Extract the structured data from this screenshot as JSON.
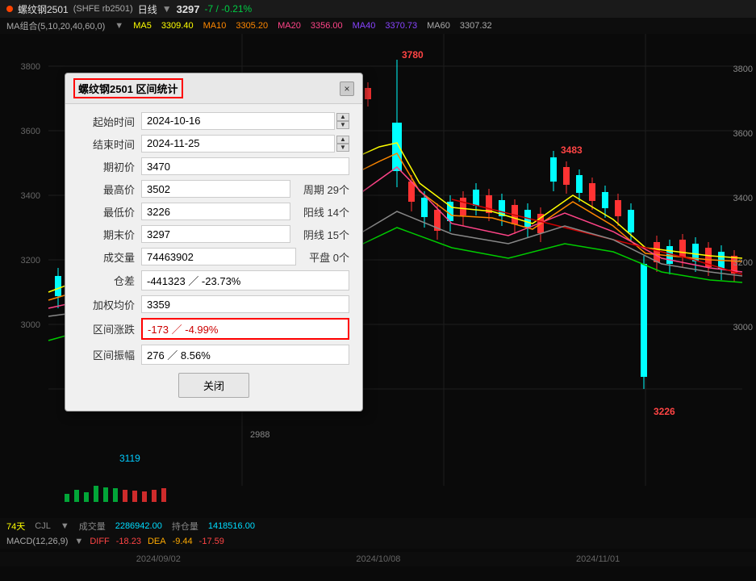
{
  "topbar": {
    "dot_color": "#ff4400",
    "title": "螺纹钢2501",
    "exchange": "(SHFE rb2501)",
    "period": "日线",
    "price": "3297",
    "change": "-7 / -0.21%"
  },
  "mabar": {
    "label": "MA组合(5,10,20,40,60,0)",
    "ma5_label": "MA5",
    "ma5_val": "3309.40",
    "ma10_label": "MA10",
    "ma10_val": "3305.20",
    "ma20_label": "MA20",
    "ma20_val": "3356.00",
    "ma40_label": "MA40",
    "ma40_val": "3370.73",
    "ma60_label": "MA60",
    "ma60_val": "3307.32"
  },
  "chart": {
    "price_3780": "3780",
    "price_3483": "3483",
    "price_3226": "3226",
    "price_3119": "3119",
    "y_labels": [
      "3800",
      "3600",
      "3400",
      "3200",
      "3000"
    ]
  },
  "bottombar": {
    "day_label": "74天",
    "price_2988": "2988",
    "cjl_label": "CJL",
    "chengjiao": "成交量",
    "cjl_val": "2286942.00",
    "chicang_label": "持仓量",
    "chicang_val": "1418516.00",
    "macd_label": "MACD(12,26,9)",
    "diff_label": "DIFF",
    "diff_val": "-18.23",
    "dea_label": "DEA",
    "dea_val": "-9.44",
    "macd_val": "-17.59"
  },
  "dates": {
    "d1": "2024/09/02",
    "d2": "2024/10/08",
    "d3": "2024/11/01"
  },
  "dialog": {
    "title": "螺纹钢2501 区间统计",
    "close_label": "×",
    "start_label": "起始时间",
    "start_val": "2024-10-16",
    "end_label": "结束时间",
    "end_val": "2024-11-25",
    "qichu_label": "期初价",
    "qichu_val": "3470",
    "zuigao_label": "最高价",
    "zuigao_val": "3502",
    "zuidi_label": "最低价",
    "zuidi_val": "3226",
    "qimo_label": "期末价",
    "qimo_val": "3297",
    "chengjiao_label": "成交量",
    "chengjiao_val": "74463902",
    "chadiff_label": "仓差",
    "chadiff_val": "-441323 ／ -23.73%",
    "jiaquan_label": "加权均价",
    "jiaquan_val": "3359",
    "rise_label": "区间涨跌",
    "rise_val": "-173 ／ -4.99%",
    "amplitude_label": "区间振幅",
    "amplitude_val": "276 ／ 8.56%",
    "zhouqi_label": "周期",
    "zhouqi_val": "29个",
    "yangxian_label": "阳线",
    "yangxian_val": "14个",
    "yinxian_label": "阴线",
    "yinxian_val": "15个",
    "pingpan_label": "平盘",
    "pingpan_val": "0个",
    "close_btn": "关闭"
  }
}
